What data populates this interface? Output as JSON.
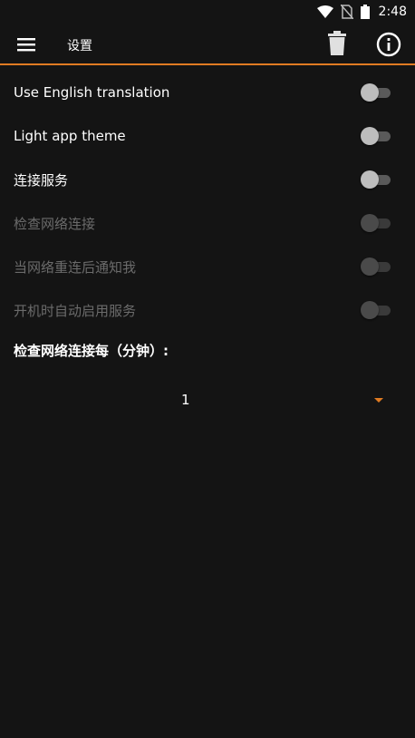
{
  "status_bar": {
    "time": "2:48"
  },
  "app_bar": {
    "title": "设置"
  },
  "settings": [
    {
      "label": "Use English translation",
      "enabled": true,
      "checked": false
    },
    {
      "label": "Light app theme",
      "enabled": true,
      "checked": false
    },
    {
      "label": "连接服务",
      "enabled": true,
      "checked": false
    },
    {
      "label": "检查网络连接",
      "enabled": false,
      "checked": false
    },
    {
      "label": "当网络重连后通知我",
      "enabled": false,
      "checked": false
    },
    {
      "label": "开机时自动启用服务",
      "enabled": false,
      "checked": false
    }
  ],
  "interval": {
    "title": "检查网络连接每（分钟）:",
    "value": "1"
  },
  "colors": {
    "accent": "#e07b22",
    "background": "#141414"
  }
}
